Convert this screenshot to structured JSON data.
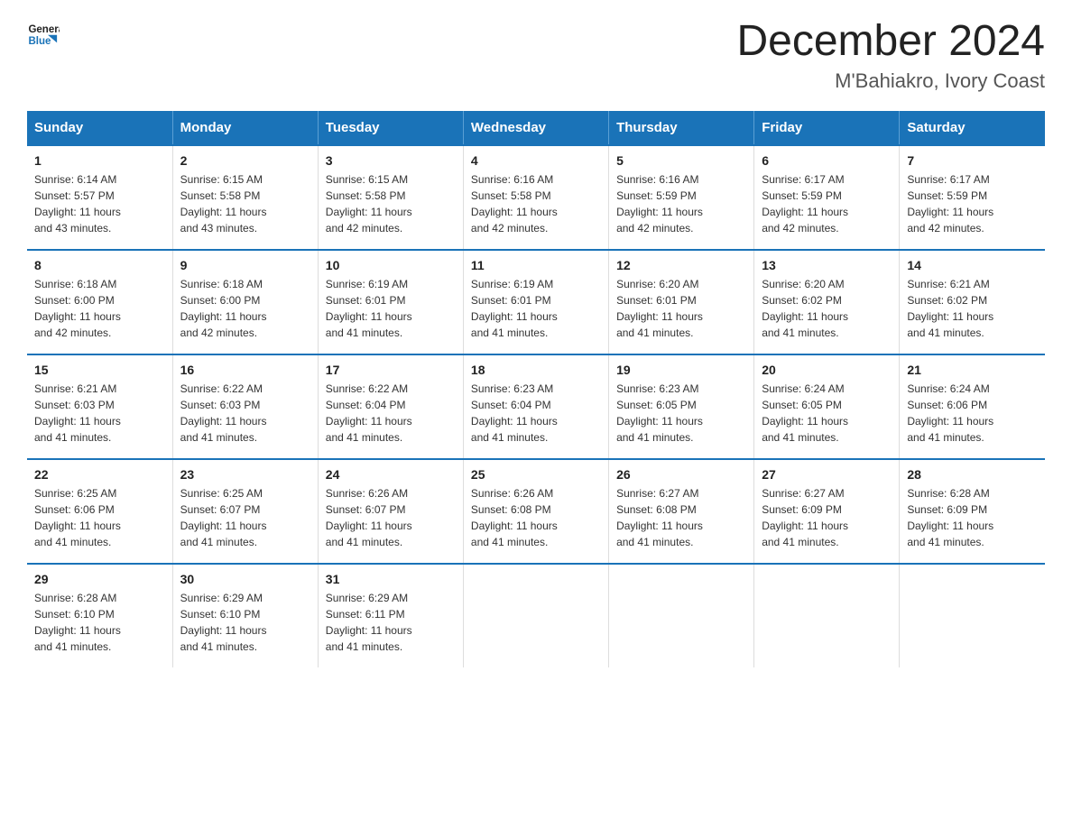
{
  "logo": {
    "general": "General",
    "blue": "Blue"
  },
  "title": "December 2024",
  "subtitle": "M'Bahiakro, Ivory Coast",
  "headers": [
    "Sunday",
    "Monday",
    "Tuesday",
    "Wednesday",
    "Thursday",
    "Friday",
    "Saturday"
  ],
  "weeks": [
    [
      {
        "day": "1",
        "sunrise": "6:14 AM",
        "sunset": "5:57 PM",
        "daylight": "11 hours and 43 minutes."
      },
      {
        "day": "2",
        "sunrise": "6:15 AM",
        "sunset": "5:58 PM",
        "daylight": "11 hours and 43 minutes."
      },
      {
        "day": "3",
        "sunrise": "6:15 AM",
        "sunset": "5:58 PM",
        "daylight": "11 hours and 42 minutes."
      },
      {
        "day": "4",
        "sunrise": "6:16 AM",
        "sunset": "5:58 PM",
        "daylight": "11 hours and 42 minutes."
      },
      {
        "day": "5",
        "sunrise": "6:16 AM",
        "sunset": "5:59 PM",
        "daylight": "11 hours and 42 minutes."
      },
      {
        "day": "6",
        "sunrise": "6:17 AM",
        "sunset": "5:59 PM",
        "daylight": "11 hours and 42 minutes."
      },
      {
        "day": "7",
        "sunrise": "6:17 AM",
        "sunset": "5:59 PM",
        "daylight": "11 hours and 42 minutes."
      }
    ],
    [
      {
        "day": "8",
        "sunrise": "6:18 AM",
        "sunset": "6:00 PM",
        "daylight": "11 hours and 42 minutes."
      },
      {
        "day": "9",
        "sunrise": "6:18 AM",
        "sunset": "6:00 PM",
        "daylight": "11 hours and 42 minutes."
      },
      {
        "day": "10",
        "sunrise": "6:19 AM",
        "sunset": "6:01 PM",
        "daylight": "11 hours and 41 minutes."
      },
      {
        "day": "11",
        "sunrise": "6:19 AM",
        "sunset": "6:01 PM",
        "daylight": "11 hours and 41 minutes."
      },
      {
        "day": "12",
        "sunrise": "6:20 AM",
        "sunset": "6:01 PM",
        "daylight": "11 hours and 41 minutes."
      },
      {
        "day": "13",
        "sunrise": "6:20 AM",
        "sunset": "6:02 PM",
        "daylight": "11 hours and 41 minutes."
      },
      {
        "day": "14",
        "sunrise": "6:21 AM",
        "sunset": "6:02 PM",
        "daylight": "11 hours and 41 minutes."
      }
    ],
    [
      {
        "day": "15",
        "sunrise": "6:21 AM",
        "sunset": "6:03 PM",
        "daylight": "11 hours and 41 minutes."
      },
      {
        "day": "16",
        "sunrise": "6:22 AM",
        "sunset": "6:03 PM",
        "daylight": "11 hours and 41 minutes."
      },
      {
        "day": "17",
        "sunrise": "6:22 AM",
        "sunset": "6:04 PM",
        "daylight": "11 hours and 41 minutes."
      },
      {
        "day": "18",
        "sunrise": "6:23 AM",
        "sunset": "6:04 PM",
        "daylight": "11 hours and 41 minutes."
      },
      {
        "day": "19",
        "sunrise": "6:23 AM",
        "sunset": "6:05 PM",
        "daylight": "11 hours and 41 minutes."
      },
      {
        "day": "20",
        "sunrise": "6:24 AM",
        "sunset": "6:05 PM",
        "daylight": "11 hours and 41 minutes."
      },
      {
        "day": "21",
        "sunrise": "6:24 AM",
        "sunset": "6:06 PM",
        "daylight": "11 hours and 41 minutes."
      }
    ],
    [
      {
        "day": "22",
        "sunrise": "6:25 AM",
        "sunset": "6:06 PM",
        "daylight": "11 hours and 41 minutes."
      },
      {
        "day": "23",
        "sunrise": "6:25 AM",
        "sunset": "6:07 PM",
        "daylight": "11 hours and 41 minutes."
      },
      {
        "day": "24",
        "sunrise": "6:26 AM",
        "sunset": "6:07 PM",
        "daylight": "11 hours and 41 minutes."
      },
      {
        "day": "25",
        "sunrise": "6:26 AM",
        "sunset": "6:08 PM",
        "daylight": "11 hours and 41 minutes."
      },
      {
        "day": "26",
        "sunrise": "6:27 AM",
        "sunset": "6:08 PM",
        "daylight": "11 hours and 41 minutes."
      },
      {
        "day": "27",
        "sunrise": "6:27 AM",
        "sunset": "6:09 PM",
        "daylight": "11 hours and 41 minutes."
      },
      {
        "day": "28",
        "sunrise": "6:28 AM",
        "sunset": "6:09 PM",
        "daylight": "11 hours and 41 minutes."
      }
    ],
    [
      {
        "day": "29",
        "sunrise": "6:28 AM",
        "sunset": "6:10 PM",
        "daylight": "11 hours and 41 minutes."
      },
      {
        "day": "30",
        "sunrise": "6:29 AM",
        "sunset": "6:10 PM",
        "daylight": "11 hours and 41 minutes."
      },
      {
        "day": "31",
        "sunrise": "6:29 AM",
        "sunset": "6:11 PM",
        "daylight": "11 hours and 41 minutes."
      },
      null,
      null,
      null,
      null
    ]
  ],
  "labels": {
    "sunrise": "Sunrise:",
    "sunset": "Sunset:",
    "daylight": "Daylight:"
  }
}
